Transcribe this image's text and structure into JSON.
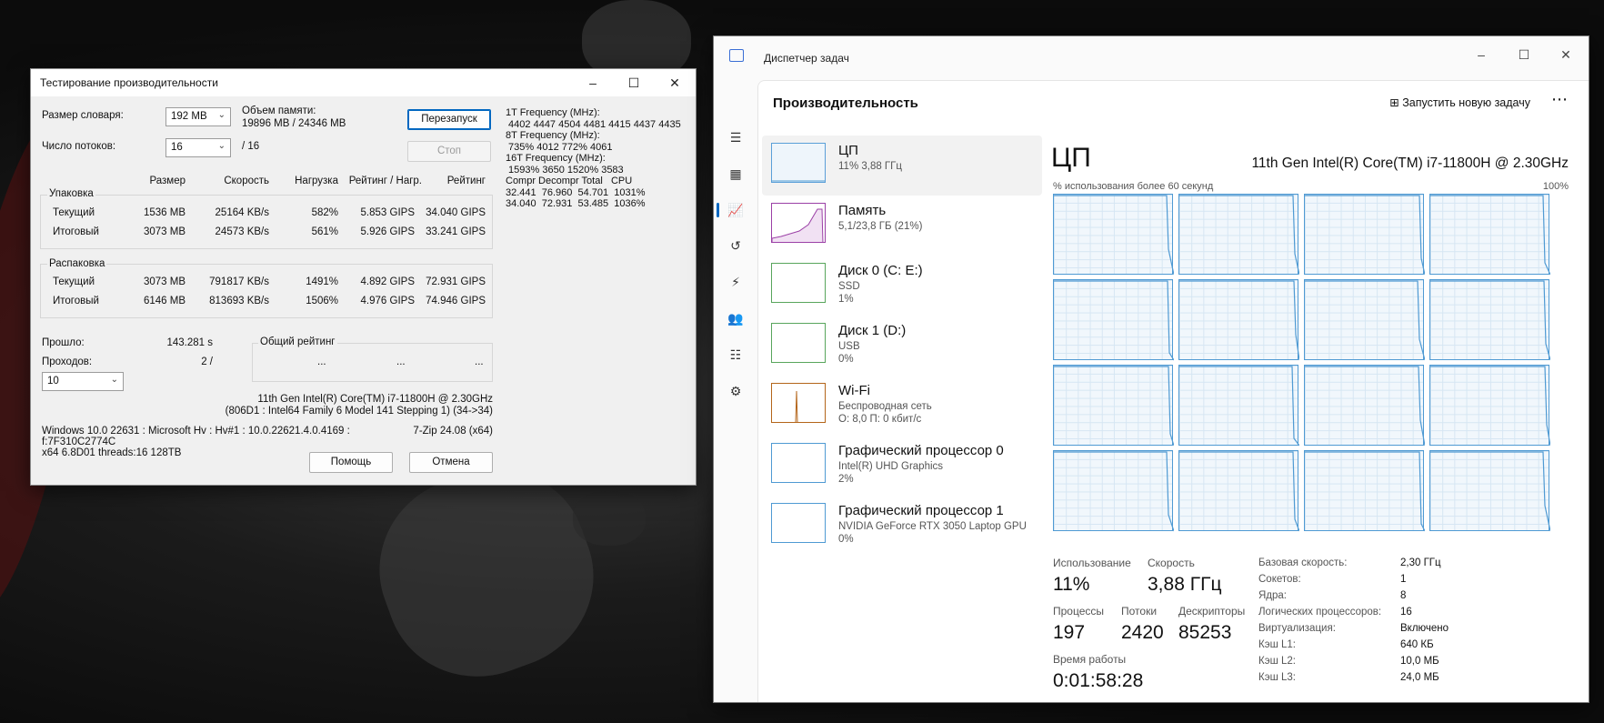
{
  "zip": {
    "title": "Тестирование производительности",
    "dict_label": "Размер словаря:",
    "dict_value": "192 MB",
    "threads_label": "Число потоков:",
    "threads_value": "16",
    "threads_max": "/ 16",
    "mem_label": "Объем памяти:",
    "mem_value": "19896 MB / 24346 MB",
    "restart_btn": "Перезапуск",
    "stop_btn": "Стоп",
    "freq": [
      "1T Frequency (MHz):",
      " 4402 4447 4504 4481 4415 4437 4435",
      "8T Frequency (MHz):",
      " 735% 4012 772% 4061",
      "16T Frequency (MHz):",
      " 1593% 3650 1520% 3583",
      "Compr Decompr Total   CPU",
      "32.441  76.960  54.701  1031%",
      "34.040  72.931  53.485  1036%"
    ],
    "col_headers": [
      "Размер",
      "Скорость",
      "Нагрузка",
      "Рейтинг / Нагр.",
      "Рейтинг"
    ],
    "pack": {
      "label": "Упаковка",
      "rows": [
        {
          "name": "Текущий",
          "size": "1536 MB",
          "speed": "25164 KB/s",
          "load": "582%",
          "rpu": "5.853 GIPS",
          "rating": "34.040 GIPS"
        },
        {
          "name": "Итоговый",
          "size": "3073 MB",
          "speed": "24573 KB/s",
          "load": "561%",
          "rpu": "5.926 GIPS",
          "rating": "33.241 GIPS"
        }
      ]
    },
    "unpack": {
      "label": "Распаковка",
      "rows": [
        {
          "name": "Текущий",
          "size": "3073 MB",
          "speed": "791817 KB/s",
          "load": "1491%",
          "rpu": "4.892 GIPS",
          "rating": "72.931 GIPS"
        },
        {
          "name": "Итоговый",
          "size": "6146 MB",
          "speed": "813693 KB/s",
          "load": "1506%",
          "rpu": "4.976 GIPS",
          "rating": "74.946 GIPS"
        }
      ]
    },
    "elapsed_label": "Прошло:",
    "elapsed_value": "143.281 s",
    "passes_label": "Проходов:",
    "passes_value": "2 /",
    "passes_select": "10",
    "total_label": "Общий рейтинг",
    "total_vals": [
      "...",
      "...",
      "..."
    ],
    "cpu_line1": "11th Gen Intel(R) Core(TM) i7-11800H @ 2.30GHz",
    "cpu_line2": "(806D1 : Intel64 Family 6 Model 141 Stepping 1) (34->34)",
    "sys_line1": "Windows 10.0 22631 : Microsoft Hv : Hv#1 : 10.0.22621.4.0.4169 :",
    "sys_line2": "f:7F310C2774C",
    "sys_line3": "x64 6.8D01 threads:16 128TB",
    "version": "7-Zip 24.08 (x64)",
    "help_btn": "Помощь",
    "cancel_btn": "Отмена"
  },
  "tm": {
    "title": "Диспетчер задач",
    "section": "Производительность",
    "run_task": "Запустить новую задачу",
    "more": "⋯",
    "devices": [
      {
        "name": "ЦП",
        "l2": "11% 3,88 ГГц",
        "l3": ""
      },
      {
        "name": "Память",
        "l2": "5,1/23,8 ГБ (21%)",
        "l3": ""
      },
      {
        "name": "Диск 0 (C: E:)",
        "l2": "SSD",
        "l3": "1%"
      },
      {
        "name": "Диск 1 (D:)",
        "l2": "USB",
        "l3": "0%"
      },
      {
        "name": "Wi-Fi",
        "l2": "Беспроводная сеть",
        "l3": "О: 8,0 П: 0 кбит/с"
      },
      {
        "name": "Графический процессор 0",
        "l2": "Intel(R) UHD Graphics",
        "l3": "2%"
      },
      {
        "name": "Графический процессор 1",
        "l2": "NVIDIA GeForce RTX 3050 Laptop GPU",
        "l3": "0%"
      }
    ],
    "detail_title": "ЦП",
    "cpu_model": "11th Gen Intel(R) Core(TM) i7-11800H @ 2.30GHz",
    "graph_label": "% использования более 60 секунд",
    "graph_max": "100%",
    "stats": {
      "usage_label": "Использование",
      "usage": "11%",
      "speed_label": "Скорость",
      "speed": "3,88 ГГц",
      "proc_label": "Процессы",
      "proc": "197",
      "threads_label": "Потоки",
      "threads": "2420",
      "handles_label": "Дескрипторы",
      "handles": "85253",
      "uptime_label": "Время работы",
      "uptime": "0:01:58:28"
    },
    "specs": [
      {
        "k": "Базовая скорость:",
        "v": "2,30 ГГц"
      },
      {
        "k": "Сокетов:",
        "v": "1"
      },
      {
        "k": "Ядра:",
        "v": "8"
      },
      {
        "k": "Логических процессоров:",
        "v": "16"
      },
      {
        "k": "Виртуализация:",
        "v": "Включено"
      },
      {
        "k": "Кэш L1:",
        "v": "640 КБ"
      },
      {
        "k": "Кэш L2:",
        "v": "10,0 МБ"
      },
      {
        "k": "Кэш L3:",
        "v": "24,0 МБ"
      }
    ],
    "colors": {
      "cpu": "#4f9ad3",
      "memory": "#9b40a6",
      "wifi": "#b4651a"
    }
  }
}
